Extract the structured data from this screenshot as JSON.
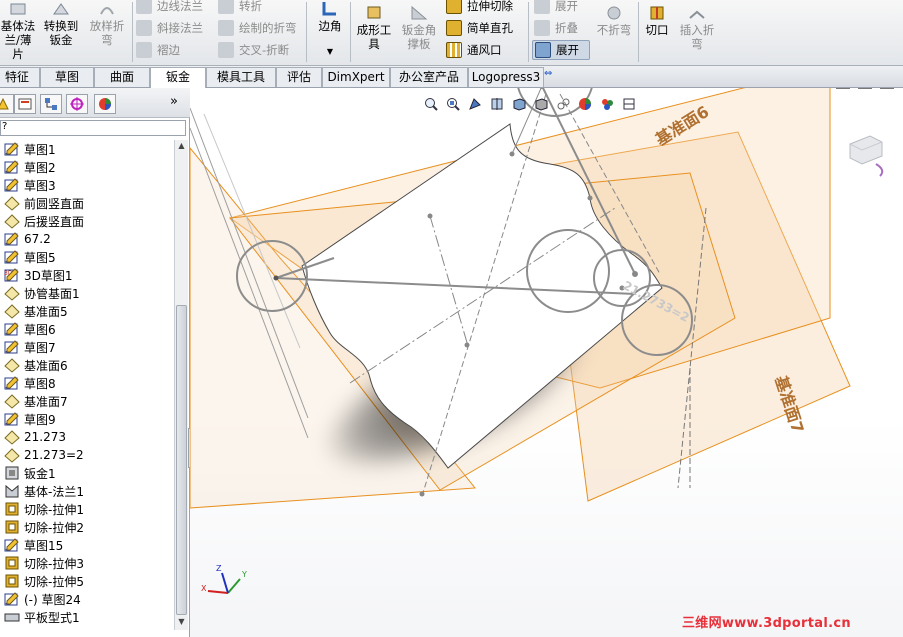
{
  "ribbon": {
    "big_left": [
      {
        "name": "base-flange-button",
        "label1": "基体法",
        "label2": "兰/薄片",
        "disabled": false
      },
      {
        "name": "convert-to-sheet-metal-button",
        "label1": "转换到",
        "label2": "钣金",
        "disabled": false
      },
      {
        "name": "lofted-bend-button",
        "label1": "放样折",
        "label2": "弯",
        "disabled": true
      }
    ],
    "col1": [
      {
        "name": "edge-flange-button",
        "label": "边线法兰",
        "disabled": true
      },
      {
        "name": "miter-flange-button",
        "label": "斜接法兰",
        "disabled": true
      },
      {
        "name": "hem-button",
        "label": "褶边",
        "disabled": true
      }
    ],
    "col2": [
      {
        "name": "jog-button",
        "label": "转折",
        "disabled": true
      },
      {
        "name": "sketched-bend-button",
        "label": "绘制的折弯",
        "disabled": true
      },
      {
        "name": "cross-break-button",
        "label": "交叉-折断",
        "disabled": true
      }
    ],
    "corner": {
      "label": "边角"
    },
    "forming_tool": {
      "label1": "成形工",
      "label2": "具"
    },
    "gusset": {
      "label1": "钣金角",
      "label2": "撑板"
    },
    "col3": [
      {
        "name": "extruded-cut-button",
        "label": "拉伸切除"
      },
      {
        "name": "simple-hole-button",
        "label": "简单直孔"
      },
      {
        "name": "vent-button",
        "label": "通风口"
      }
    ],
    "col4": [
      {
        "name": "unfold-button",
        "label": "展开",
        "disabled": true
      },
      {
        "name": "fold-button",
        "label": "折叠",
        "disabled": true
      },
      {
        "name": "flatten-button",
        "label": "展开",
        "disabled": false
      }
    ],
    "no_bends": {
      "label": "不折弯"
    },
    "rip": {
      "label": "切口"
    },
    "insert_bends": {
      "label1": "插入折",
      "label2": "弯"
    }
  },
  "tabs": [
    {
      "label": "特征",
      "active": false
    },
    {
      "label": "草图",
      "active": false
    },
    {
      "label": "曲面",
      "active": false
    },
    {
      "label": "钣金",
      "active": true
    },
    {
      "label": "模具工具",
      "active": false
    },
    {
      "label": "评估",
      "active": false
    },
    {
      "label": "DimXpert",
      "active": false
    },
    {
      "label": "办公室产品",
      "active": false
    },
    {
      "label": "Logopress3",
      "active": false
    }
  ],
  "feature_tree": {
    "filter_text": "?",
    "items": [
      {
        "label": "草图1",
        "icon": "sketch-icon"
      },
      {
        "label": "草图2",
        "icon": "sketch-icon"
      },
      {
        "label": "草图3",
        "icon": "sketch-icon"
      },
      {
        "label": "前圆竖直面",
        "icon": "plane-icon"
      },
      {
        "label": "后援竖直面",
        "icon": "plane-icon"
      },
      {
        "label": "67.2",
        "icon": "sketch-icon"
      },
      {
        "label": "草图5",
        "icon": "sketch-icon"
      },
      {
        "label": "3D草图1",
        "icon": "3d-sketch-icon"
      },
      {
        "label": "协管基面1",
        "icon": "plane-icon"
      },
      {
        "label": "基准面5",
        "icon": "plane-icon"
      },
      {
        "label": "草图6",
        "icon": "sketch-icon"
      },
      {
        "label": "草图7",
        "icon": "sketch-icon"
      },
      {
        "label": "基准面6",
        "icon": "plane-icon"
      },
      {
        "label": "草图8",
        "icon": "sketch-icon"
      },
      {
        "label": "基准面7",
        "icon": "plane-icon"
      },
      {
        "label": "草图9",
        "icon": "sketch-icon"
      },
      {
        "label": "21.273",
        "icon": "plane-icon"
      },
      {
        "label": "21.273=2",
        "icon": "plane-icon"
      },
      {
        "label": "钣金1",
        "icon": "sheet-metal-icon"
      },
      {
        "label": "基体-法兰1",
        "icon": "base-flange-icon"
      },
      {
        "label": "切除-拉伸1",
        "icon": "cut-extrude-icon"
      },
      {
        "label": "切除-拉伸2",
        "icon": "cut-extrude-icon"
      },
      {
        "label": "草图15",
        "icon": "sketch-icon"
      },
      {
        "label": "切除-拉伸3",
        "icon": "cut-extrude-icon"
      },
      {
        "label": "切除-拉伸5",
        "icon": "cut-extrude-icon"
      },
      {
        "label": "(-) 草图24",
        "icon": "sketch-icon"
      },
      {
        "label": "平板型式1",
        "icon": "flat-pattern-icon"
      }
    ]
  },
  "viewport": {
    "plane_labels": [
      {
        "name": "plane-label-6",
        "label": "基准面6"
      },
      {
        "name": "plane-label-7",
        "label": "基准面7"
      }
    ],
    "dim_label": "21.2733=2",
    "triad": {
      "x": "X",
      "y": "Y",
      "z": "Z"
    }
  },
  "watermark": "三维网www.3dportal.cn",
  "colors": {
    "plane_orange": "#f0a040",
    "plane_edge": "#e8901e",
    "plane_label": "#b07030",
    "sketch_gray": "#8c8c8c",
    "watermark_red": "#e8303a"
  }
}
